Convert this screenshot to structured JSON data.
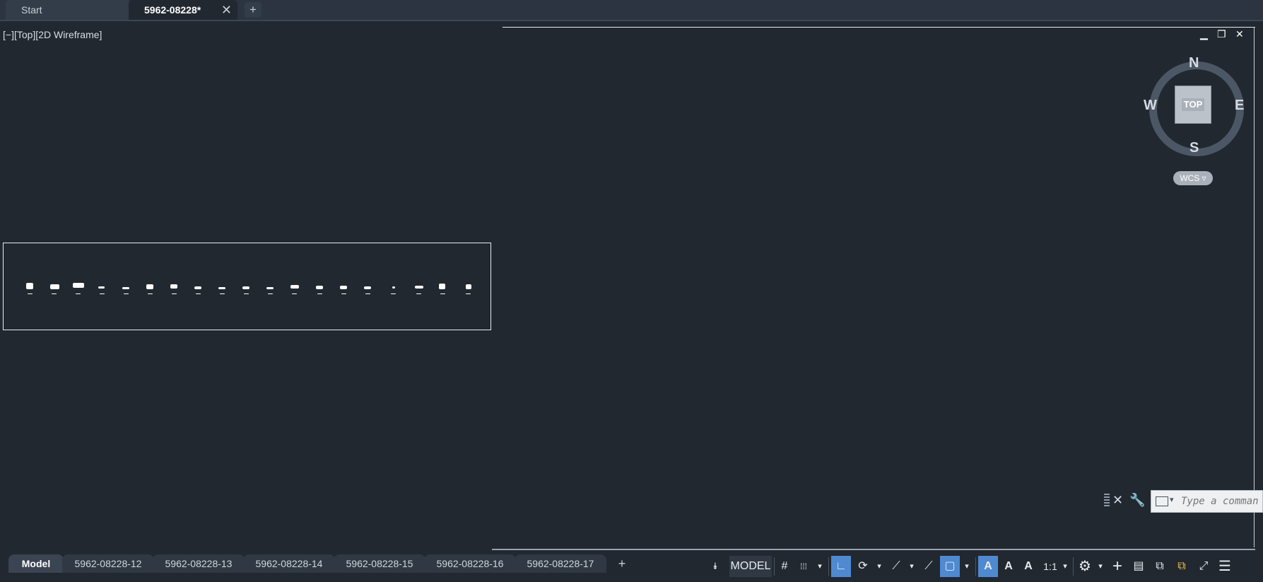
{
  "file_tabs": {
    "start": "Start",
    "active": "5962-08228*",
    "close_glyph": "✕",
    "add_glyph": "+"
  },
  "viewport": {
    "label": "[−][Top][2D Wireframe]",
    "controls": {
      "minimize": "▁",
      "restore": "❐",
      "close": "✕"
    }
  },
  "viewcube": {
    "north": "N",
    "south": "S",
    "east": "E",
    "west": "W",
    "face": "TOP",
    "wcs": "WCS ▿"
  },
  "command_line": {
    "placeholder": "Type a comman",
    "close_glyph": "✕",
    "settings_glyph": "🔧"
  },
  "layout_tabs": {
    "tabs": [
      "Model",
      "5962-08228-12",
      "5962-08228-13",
      "5962-08228-14",
      "5962-08228-15",
      "5962-08228-16",
      "5962-08228-17"
    ],
    "active_index": 0,
    "add_glyph": "+"
  },
  "status_bar": {
    "overflow_glyph": "⯯",
    "model": "MODEL",
    "grid_icon": "#",
    "snap_icon": "⁞⁞⁞",
    "ortho_icon": "∟",
    "polar_icon": "⟳",
    "isodraft_icon": "⟋",
    "osnap_icon": "▢",
    "annotation_visibility_icon": "A",
    "annotation_scale": "1:1",
    "workspace_icon": "⚙",
    "plus_icon": "+",
    "properties_icon": "▤",
    "isolate_icon": "⧉",
    "clean_screen_icon": "⤢",
    "menu_icon": "☰",
    "caret": "▾"
  },
  "colors": {
    "background": "#212830",
    "active_blue": "#4f8ad1"
  }
}
